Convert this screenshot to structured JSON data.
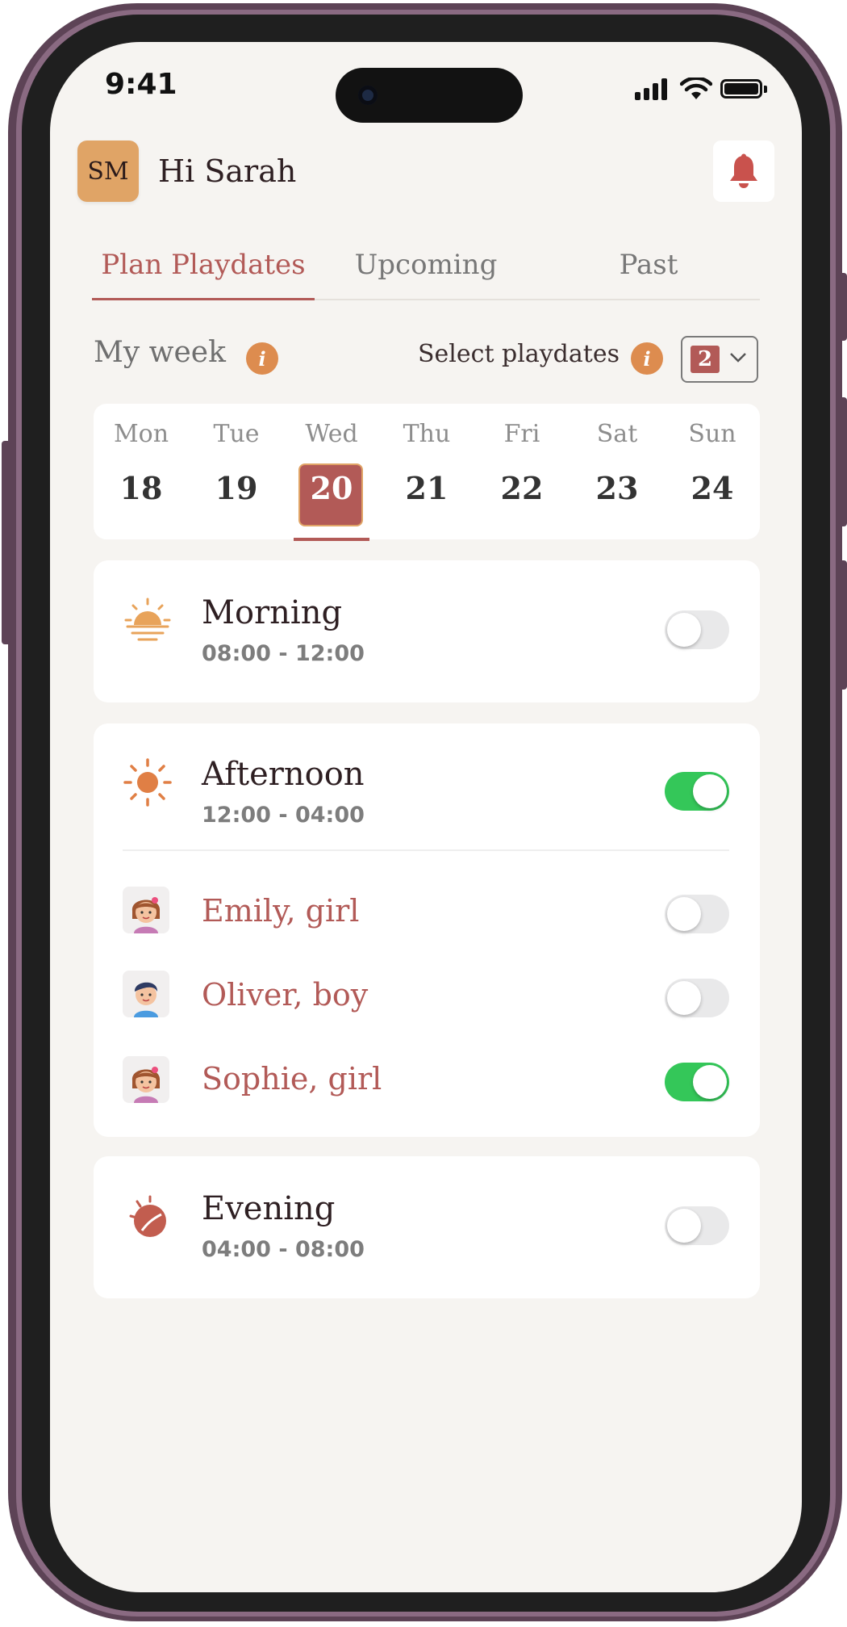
{
  "status_bar": {
    "time": "9:41"
  },
  "header": {
    "avatar_initials": "SM",
    "greeting": "Hi Sarah"
  },
  "tabs": [
    {
      "label": "Plan Playdates",
      "active": true
    },
    {
      "label": "Upcoming",
      "active": false
    },
    {
      "label": "Past",
      "active": false
    }
  ],
  "section": {
    "title": "My week",
    "select_label": "Select playdates",
    "selected_count": "2"
  },
  "week": {
    "selected_index": 2,
    "days": [
      {
        "name": "Mon",
        "num": "18"
      },
      {
        "name": "Tue",
        "num": "19"
      },
      {
        "name": "Wed",
        "num": "20"
      },
      {
        "name": "Thu",
        "num": "21"
      },
      {
        "name": "Fri",
        "num": "22"
      },
      {
        "name": "Sat",
        "num": "23"
      },
      {
        "name": "Sun",
        "num": "24"
      }
    ]
  },
  "slots": {
    "morning": {
      "title": "Morning",
      "time": "08:00 - 12:00",
      "enabled": false,
      "icon": "sunrise-icon"
    },
    "afternoon": {
      "title": "Afternoon",
      "time": "12:00 - 04:00",
      "enabled": true,
      "icon": "sun-icon",
      "children": [
        {
          "name": "Emily, girl",
          "enabled": false,
          "icon": "girl-avatar-icon"
        },
        {
          "name": "Oliver, boy",
          "enabled": false,
          "icon": "boy-avatar-icon"
        },
        {
          "name": "Sophie, girl",
          "enabled": true,
          "icon": "girl-avatar-icon"
        }
      ]
    },
    "evening": {
      "title": "Evening",
      "time": "04:00 - 08:00",
      "enabled": false,
      "icon": "moon-icon"
    }
  },
  "colors": {
    "accent": "#b25a57",
    "avatar_bg": "#e0a466",
    "info_icon": "#dd8c4f",
    "toggle_on": "#34c759",
    "background": "#f6f4f1"
  }
}
